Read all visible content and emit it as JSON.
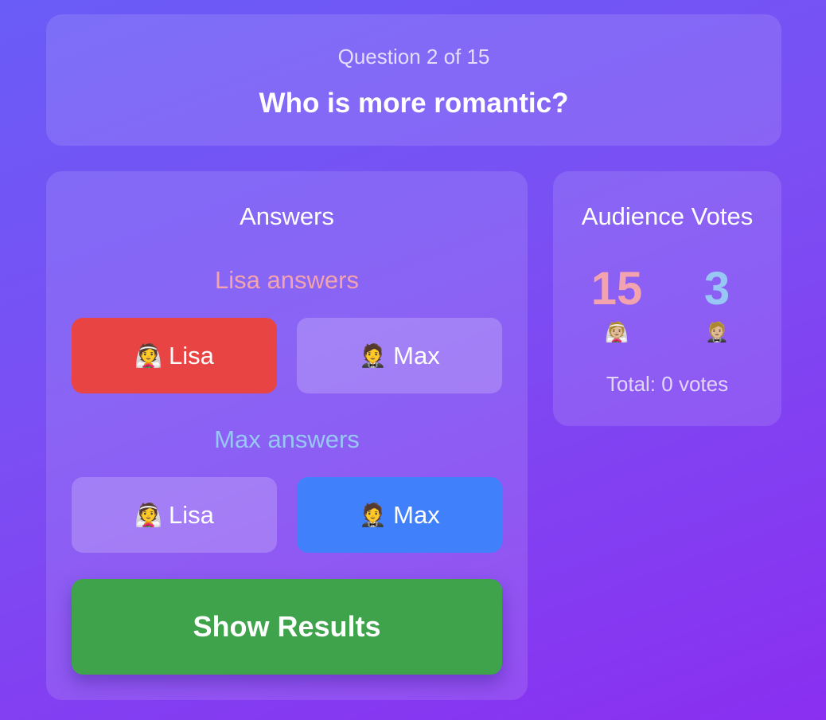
{
  "question": {
    "counter": "Question 2 of 15",
    "text": "Who is more romantic?"
  },
  "answers": {
    "title": "Answers",
    "lisa_section": {
      "label": "Lisa answers",
      "options": [
        {
          "emoji": "👰",
          "name": "Lisa",
          "selected": true,
          "selected_color": "#e84443"
        },
        {
          "emoji": "🤵",
          "name": "Max",
          "selected": false
        }
      ]
    },
    "max_section": {
      "label": "Max answers",
      "options": [
        {
          "emoji": "👰",
          "name": "Lisa",
          "selected": false
        },
        {
          "emoji": "🤵",
          "name": "Max",
          "selected": true,
          "selected_color": "#4180fb"
        }
      ]
    },
    "show_results_label": "Show Results"
  },
  "votes": {
    "title": "Audience Votes",
    "lisa": {
      "count": "15",
      "emoji": "👰🏼"
    },
    "max": {
      "count": "3",
      "emoji": "🤵🏼"
    },
    "total": "Total: 0 votes"
  },
  "colors": {
    "lisa_accent": "#f2a3ad",
    "max_accent": "#99c7f5",
    "show_results": "#3fa34b"
  }
}
